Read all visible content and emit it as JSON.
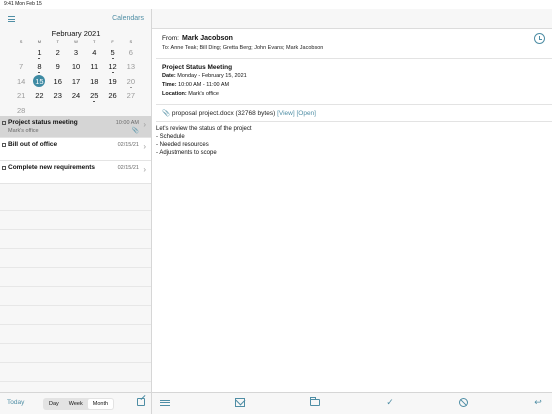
{
  "status_bar": {
    "time": "9:41",
    "date": "Mon Feb 15"
  },
  "sidebar": {
    "calendars_label": "Calendars",
    "month_title": "February 2021",
    "weekdays": [
      "S",
      "M",
      "T",
      "W",
      "T",
      "F",
      "S"
    ],
    "selected_day": "15",
    "days": [
      {
        "n": "",
        "w": false,
        "dot": false
      },
      {
        "n": "1",
        "w": false,
        "dot": true
      },
      {
        "n": "2",
        "w": false,
        "dot": false
      },
      {
        "n": "3",
        "w": false,
        "dot": false
      },
      {
        "n": "4",
        "w": false,
        "dot": false
      },
      {
        "n": "5",
        "w": false,
        "dot": true
      },
      {
        "n": "6",
        "w": true,
        "dot": false
      },
      {
        "n": "7",
        "w": true,
        "dot": false
      },
      {
        "n": "8",
        "w": false,
        "dot": true
      },
      {
        "n": "9",
        "w": false,
        "dot": false
      },
      {
        "n": "10",
        "w": false,
        "dot": false
      },
      {
        "n": "11",
        "w": false,
        "dot": false
      },
      {
        "n": "12",
        "w": false,
        "dot": true
      },
      {
        "n": "13",
        "w": true,
        "dot": false
      },
      {
        "n": "14",
        "w": true,
        "dot": false
      },
      {
        "n": "15",
        "w": false,
        "dot": false
      },
      {
        "n": "16",
        "w": false,
        "dot": false
      },
      {
        "n": "17",
        "w": false,
        "dot": false
      },
      {
        "n": "18",
        "w": false,
        "dot": false
      },
      {
        "n": "19",
        "w": false,
        "dot": false
      },
      {
        "n": "20",
        "w": true,
        "dot": true
      },
      {
        "n": "21",
        "w": true,
        "dot": false
      },
      {
        "n": "22",
        "w": false,
        "dot": false
      },
      {
        "n": "23",
        "w": false,
        "dot": false
      },
      {
        "n": "24",
        "w": false,
        "dot": false
      },
      {
        "n": "25",
        "w": false,
        "dot": true
      },
      {
        "n": "26",
        "w": false,
        "dot": false
      },
      {
        "n": "27",
        "w": true,
        "dot": false
      },
      {
        "n": "28",
        "w": true,
        "dot": false
      }
    ]
  },
  "events": [
    {
      "title": "Project status meeting",
      "sub": "Mark's office",
      "time": "10:00 AM",
      "attachment": true
    },
    {
      "title": "Bill out of office",
      "sub": "",
      "time": "02/15/21",
      "attachment": false
    },
    {
      "title": "Complete new requirements",
      "sub": "",
      "time": "02/15/21",
      "attachment": false
    }
  ],
  "left_toolbar": {
    "today_label": "Today",
    "views": [
      "Day",
      "Week",
      "Month"
    ],
    "active_view": "Month"
  },
  "detail": {
    "from_label": "From:",
    "from_name": "Mark Jacobson",
    "to_line": "To:  Anne Teak; Bill Ding; Gretta Berg; John Evans; Mark Jacobson",
    "meeting_title": "Project Status Meeting",
    "date_label": "Date:",
    "date_value": "Monday - February 15, 2021",
    "time_label": "Time:",
    "time_value": "10:00 AM - 11:00 AM",
    "location_label": "Location:",
    "location_value": "Mark's office",
    "attachment_name": "proposal project.docx (32768 bytes)",
    "view_link": "[View]",
    "open_link": "[Open]",
    "body_lines": [
      "Let's review the status of the project",
      "- Schedule",
      "- Needed resources",
      "- Adjustments to scope"
    ]
  },
  "colors": {
    "accent": "#4f8ea5",
    "selected_day": "#3e8aa3",
    "selected_row": "#d5d5d5"
  }
}
